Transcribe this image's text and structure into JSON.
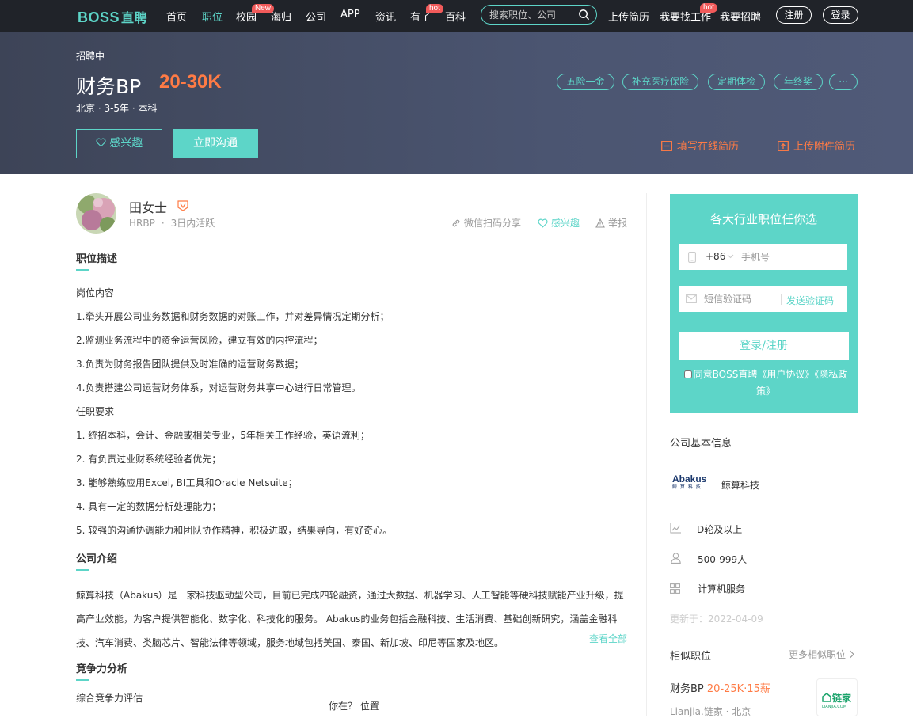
{
  "nav": {
    "logo_en": "BOSS",
    "logo_zh": "直聘",
    "links": [
      "首页",
      "职位",
      "校园",
      "海归",
      "公司",
      "APP",
      "资讯",
      "有了",
      "百科"
    ],
    "badge_new": "New",
    "badge_hot": "hot",
    "search_placeholder": "搜索职位、公司",
    "upload_resume": "上传简历",
    "find_job": "我要找工作",
    "hire": "我要招聘",
    "register": "注册",
    "login": "登录"
  },
  "job": {
    "status": "招聘中",
    "title": "财务BP",
    "salary": "20-30K",
    "meta": "北京 · 3-5年 · 本科",
    "tags": [
      "五险一金",
      "补充医疗保险",
      "定期体检",
      "年终奖",
      "···"
    ],
    "interest_btn": "感兴趣",
    "chat_btn": "立即沟通",
    "online_resume": "填写在线简历",
    "attach_resume": "上传附件简历"
  },
  "recruiter": {
    "name": "田女士",
    "role": "HRBP",
    "active": "3日内活跃",
    "share": "微信扫码分享",
    "interest": "感兴趣",
    "report": "举报"
  },
  "description": {
    "title": "职位描述",
    "lines": [
      "岗位内容",
      "1.牵头开展公司业务数据和财务数据的对账工作，并对差异情况定期分析；",
      "2.监测业务流程中的资金运营风险，建立有效的内控流程；",
      "3.负责为财务报告团队提供及时准确的运营财务数据；",
      "4.负责搭建公司运营财务体系，对运营财务共享中心进行日常管理。",
      "任职要求",
      "1. 统招本科，会计、金融或相关专业，5年相关工作经验，英语流利；",
      "2. 有负责过业财系统经验者优先；",
      "3. 能够熟练应用Excel, BI工具和Oracle Netsuite；",
      "4. 具有一定的数据分析处理能力；",
      "5. 较强的沟通协调能力和团队协作精神，积极进取，结果导向，有好奇心。"
    ]
  },
  "company_intro": {
    "title": "公司介绍",
    "text": "鲸算科技（Abakus）是一家科技驱动型公司，目前已完成四轮融资，通过大数据、机器学习、人工智能等硬科技赋能产业升级，提高产业效能，为客户提供智能化、数字化、科技化的服务。 Abakus的业务包括金融科技、生活消费、基础创新研究，涵盖金融科技、汽车消费、类脑芯片、智能法律等领域，服务地域包括美国、泰国、新加坡、印尼等国家及地区。",
    "see_all": "查看全部"
  },
  "competition": {
    "title": "竞争力分析",
    "subtitle": "综合竞争力评估"
  },
  "bottom_tip": "你在？ 位置",
  "login_box": {
    "title": "各大行业职位任你选",
    "country_code": "+86",
    "phone_placeholder": "手机号",
    "code_placeholder": "短信验证码",
    "send_code": "发送验证码",
    "submit": "登录/注册",
    "agree_pre": "同意BOSS直聘",
    "agree_terms": "《用户协议》",
    "agree_privacy": "《隐私政策》"
  },
  "company": {
    "section_title": "公司基本信息",
    "logo_en": "Abakus",
    "logo_zh": "鲸 算 科 技",
    "name": "鲸算科技",
    "stage": "D轮及以上",
    "size": "500-999人",
    "industry": "计算机服务",
    "updated": "更新于：2022-04-09"
  },
  "similar": {
    "title": "相似职位",
    "more": "更多相似职位",
    "job_title": "财务BP",
    "job_salary": "20-25K·15薪",
    "job_company": "Lianjia.链家 · 北京",
    "logo_text": "链家",
    "logo_sub": "LIANJIA.COM"
  },
  "colors": {
    "accent": "#5dd5c8",
    "salary": "#ff7b45",
    "nav_bg": "#202329"
  }
}
